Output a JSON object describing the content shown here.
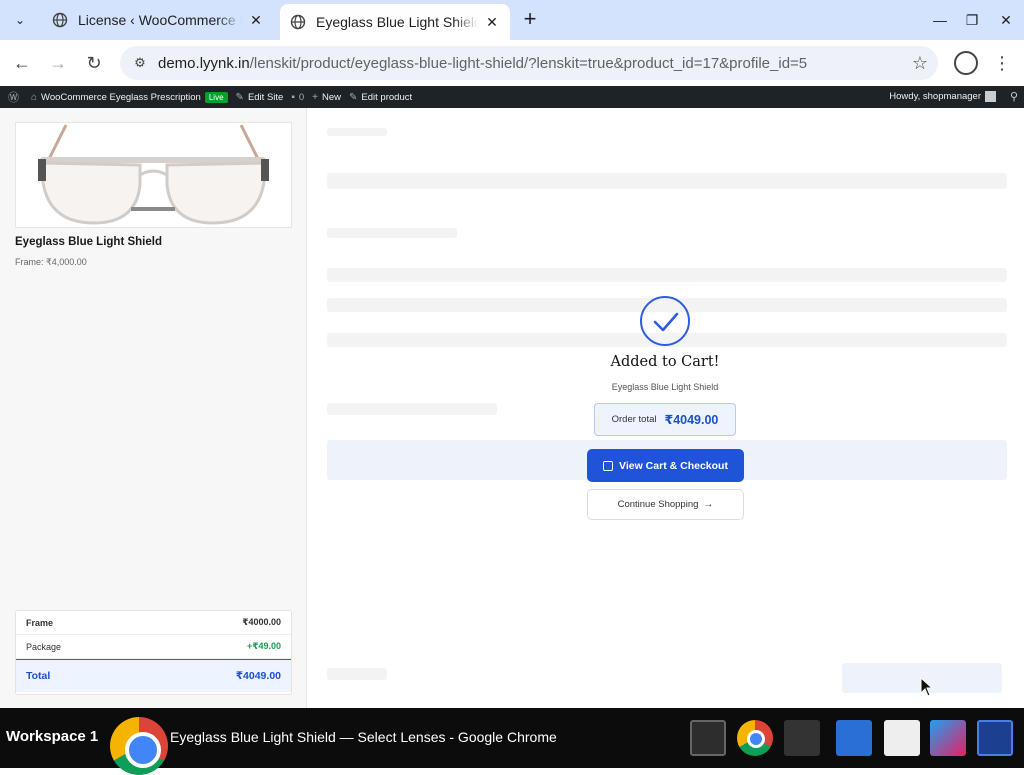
{
  "browser": {
    "tabs": [
      {
        "title": "License ‹ WooCommerce Eyeglass Prescription",
        "active": false
      },
      {
        "title": "Eyeglass Blue Light Shield — Select Lenses",
        "active": true
      }
    ],
    "url_host": "demo.lyynk.in",
    "url_path": "/lenskit/product/eyeglass-blue-light-shield/?lenskit=true&product_id=17&profile_id=5"
  },
  "wp_admin_bar": {
    "site_name": "WooCommerce Eyeglass Prescription",
    "live_badge": "Live",
    "edit_site": "Edit Site",
    "comments_count": "0",
    "new": "New",
    "edit_product": "Edit product",
    "howdy": "Howdy, shopmanager"
  },
  "product": {
    "name": "Eyeglass Blue Light Shield",
    "frame_price": "Frame: ₹4,000.00"
  },
  "summary": {
    "frame_label": "Frame",
    "frame_value": "₹4000.00",
    "package_label": "Package",
    "package_value": "+₹49.00",
    "total_label": "Total",
    "total_value": "₹4049.00"
  },
  "modal": {
    "title": "Added to Cart!",
    "subtitle": "Eyeglass Blue Light Shield",
    "order_total_label": "Order total",
    "order_total_value": "₹4049.00",
    "checkout_button": "View Cart & Checkout",
    "continue_button": "Continue Shopping"
  },
  "taskbar": {
    "workspace": "Workspace 1",
    "window_title": "Eyeglass Blue Light Shield — Select Lenses - Google Chrome"
  },
  "colors": {
    "accent": "#1f54d8",
    "wpbar": "#1d2327",
    "tabstrip": "#d3e3fd"
  }
}
